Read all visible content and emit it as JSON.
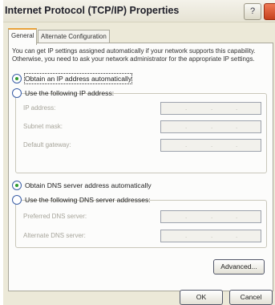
{
  "window": {
    "title": "Internet Protocol (TCP/IP) Properties",
    "help_label": "?"
  },
  "tabs": [
    {
      "label": "General",
      "selected": true
    },
    {
      "label": "Alternate Configuration",
      "selected": false
    }
  ],
  "description": "You can get IP settings assigned automatically if your network supports this capability. Otherwise, you need to ask your network administrator for the appropriate IP settings.",
  "ip_mode": {
    "auto_label": "Obtain an IP address automatically",
    "manual_label": "Use the following IP address:",
    "selected": "auto"
  },
  "ip_fields": [
    {
      "label": "IP address:",
      "value": "",
      "enabled": false
    },
    {
      "label": "Subnet mask:",
      "value": "",
      "enabled": false
    },
    {
      "label": "Default gateway:",
      "value": "",
      "enabled": false
    }
  ],
  "dns_mode": {
    "auto_label": "Obtain DNS server address automatically",
    "manual_label": "Use the following DNS server addresses:",
    "selected": "auto"
  },
  "dns_fields": [
    {
      "label": "Preferred DNS server:",
      "value": "",
      "enabled": false
    },
    {
      "label": "Alternate DNS server:",
      "value": "",
      "enabled": false
    }
  ],
  "buttons": {
    "advanced": "Advanced...",
    "ok": "OK",
    "cancel": "Cancel"
  },
  "colors": {
    "accent_tab": "#e8a23a",
    "radio_dot": "#2f9a2f",
    "close_red": "#c5401c"
  }
}
